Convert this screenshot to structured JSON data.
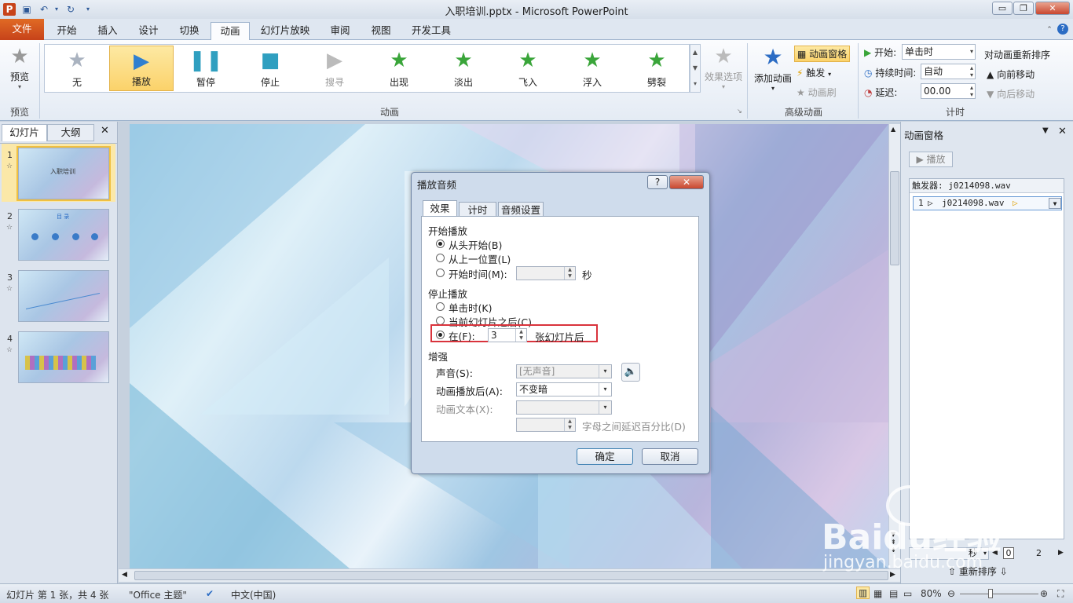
{
  "window": {
    "title": "入职培训.pptx - Microsoft PowerPoint",
    "minimize": "▭",
    "restore": "❐",
    "close": "✕"
  },
  "tabs": [
    "文件",
    "开始",
    "插入",
    "设计",
    "切换",
    "动画",
    "幻灯片放映",
    "审阅",
    "视图",
    "开发工具"
  ],
  "ribbon": {
    "preview": {
      "label": "预览",
      "group": "预览"
    },
    "gallery": {
      "group": "动画",
      "items": [
        "无",
        "播放",
        "暂停",
        "停止",
        "搜寻",
        "出现",
        "淡出",
        "飞入",
        "浮入",
        "劈裂"
      ],
      "selected": "播放"
    },
    "effect_options": "效果选项",
    "advanced": {
      "group": "高级动画",
      "add_animation": "添加动画",
      "animation_pane": "动画窗格",
      "trigger": "触发",
      "painter": "动画刷"
    },
    "timing": {
      "group": "计时",
      "start_label": "开始:",
      "start_value": "单击时",
      "duration_label": "持续时间:",
      "duration_value": "自动",
      "delay_label": "延迟:",
      "delay_value": "00.00",
      "reorder_title": "对动画重新排序",
      "move_earlier": "向前移动",
      "move_later": "向后移动"
    }
  },
  "slides_pane": {
    "tabs": [
      "幻灯片",
      "大纲"
    ],
    "close": "✕",
    "slides": [
      {
        "num": "1",
        "title": "入职培训"
      },
      {
        "num": "2",
        "title": "目 录"
      },
      {
        "num": "3",
        "title": ""
      },
      {
        "num": "4",
        "title": ""
      }
    ]
  },
  "anim_pane": {
    "title": "动画窗格",
    "play": "播放",
    "trigger_label": "触发器: j0214098.wav",
    "item_num": "1",
    "item_name": "j0214098.wav",
    "seconds": "秒",
    "page_start": "0",
    "page_end": "2",
    "reorder": "重新排序"
  },
  "dialog": {
    "title": "播放音频",
    "help": "?",
    "close": "✕",
    "tabs": [
      "效果",
      "计时",
      "音频设置"
    ],
    "start_section": "开始播放",
    "start_options": [
      "从头开始(B)",
      "从上一位置(L)",
      "开始时间(M):"
    ],
    "start_unit": "秒",
    "stop_section": "停止播放",
    "stop_options": [
      "单击时(K)",
      "当前幻灯片之后(C)",
      "在(F):"
    ],
    "stop_after_value": "3",
    "stop_after_unit": "张幻灯片后",
    "enhance_section": "增强",
    "sound_label": "声音(S):",
    "sound_value": "[无声音]",
    "after_anim_label": "动画播放后(A):",
    "after_anim_value": "不变暗",
    "anim_text_label": "动画文本(X):",
    "delay_pct_label": "字母之间延迟百分比(D)",
    "ok": "确定",
    "cancel": "取消"
  },
  "status": {
    "slide_info": "幻灯片 第 1 张，共 4 张",
    "theme": "\"Office 主题\"",
    "language": "中文(中国)",
    "zoom": "80%"
  },
  "watermark": {
    "brand": "Baidu经验",
    "url": "jingyan.baidu.com"
  }
}
